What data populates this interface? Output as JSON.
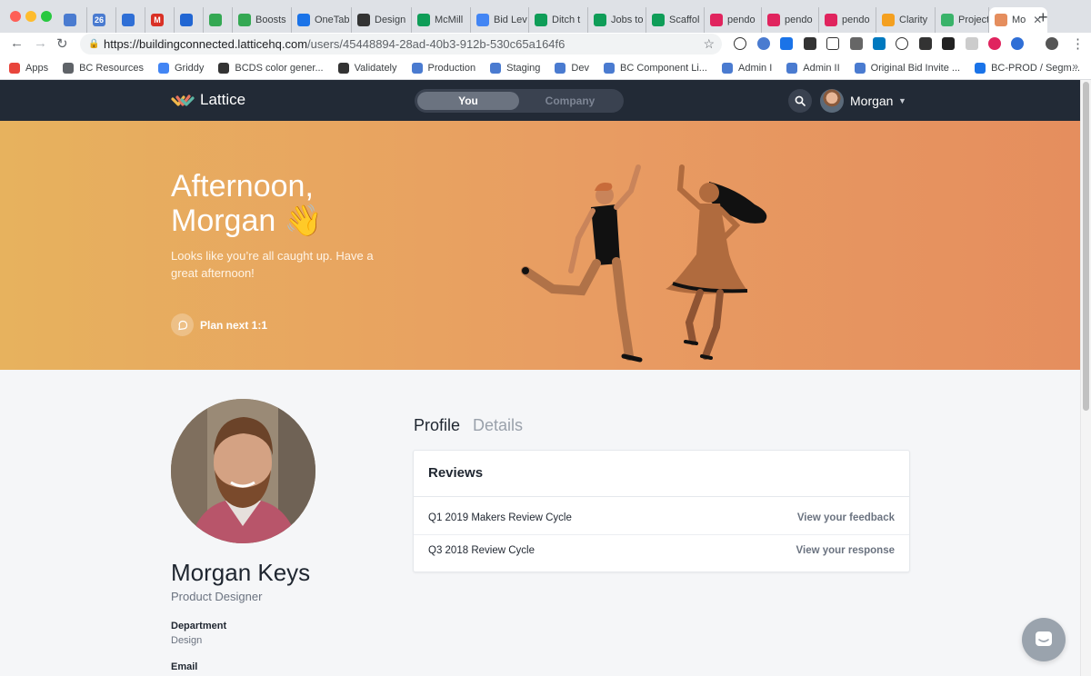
{
  "browser": {
    "tabs": [
      {
        "label": "",
        "color": "#4a7bd0"
      },
      {
        "label": "",
        "color": "#4a7bd0",
        "text": "26"
      },
      {
        "label": "",
        "color": "#2f6fd6"
      },
      {
        "label": "",
        "color": "#d93025",
        "text": "M"
      },
      {
        "label": "",
        "color": "#2166d3"
      },
      {
        "label": "",
        "color": "#34a853"
      },
      {
        "label": "Boosts",
        "color": "#34a853"
      },
      {
        "label": "OneTab",
        "color": "#1a73e8"
      },
      {
        "label": "Design",
        "color": "#333333"
      },
      {
        "label": "McMill",
        "color": "#0f9d58"
      },
      {
        "label": "Bid Lev",
        "color": "#4285f4"
      },
      {
        "label": "Ditch t",
        "color": "#0f9d58"
      },
      {
        "label": "Jobs to",
        "color": "#0f9d58"
      },
      {
        "label": "Scaffol",
        "color": "#0f9d58"
      },
      {
        "label": "pendo",
        "color": "#e0245e"
      },
      {
        "label": "pendo",
        "color": "#e0245e"
      },
      {
        "label": "pendo",
        "color": "#e0245e"
      },
      {
        "label": "Clarity",
        "color": "#f4a020"
      },
      {
        "label": "Project",
        "color": "#3ab36a"
      },
      {
        "label": "Mo",
        "color": "#e58e5e"
      }
    ],
    "new_tab": "+",
    "url_host": "https://buildingconnected.latticehq.com",
    "url_path": "/users/45448894-28ad-40b3-912b-530c65a164f6",
    "bookmarks": [
      {
        "label": "Apps",
        "color": "#e8453c"
      },
      {
        "label": "BC Resources",
        "color": "#5f6368"
      },
      {
        "label": "Griddy",
        "color": "#4285f4"
      },
      {
        "label": "BCDS color gener...",
        "color": "#333333"
      },
      {
        "label": "Validately",
        "color": "#333333"
      },
      {
        "label": "Production",
        "color": "#4a7bd0"
      },
      {
        "label": "Staging",
        "color": "#4a7bd0"
      },
      {
        "label": "Dev",
        "color": "#4a7bd0"
      },
      {
        "label": "BC Component Li...",
        "color": "#4a7bd0"
      },
      {
        "label": "Admin I",
        "color": "#4a7bd0"
      },
      {
        "label": "Admin II",
        "color": "#4a7bd0"
      },
      {
        "label": "Original Bid Invite ...",
        "color": "#4a7bd0"
      },
      {
        "label": "BC-PROD / Segm...",
        "color": "#1a73e8"
      }
    ],
    "bookmarks_more": "»"
  },
  "header": {
    "brand": "Lattice",
    "switch_you": "You",
    "switch_company": "Company",
    "user_name": "Morgan",
    "caret": "▼"
  },
  "hero": {
    "greeting_line1": "Afternoon,",
    "greeting_line2": "Morgan 👋",
    "subtext": "Looks like you’re all caught up. Have a great afternoon!",
    "plan_label": "Plan next 1:1"
  },
  "profile": {
    "name": "Morgan Keys",
    "title": "Product Designer",
    "department_label": "Department",
    "department_value": "Design",
    "email_label": "Email"
  },
  "tabs": {
    "profile": "Profile",
    "details": "Details"
  },
  "reviews": {
    "title": "Reviews",
    "items": [
      {
        "name": "Q1 2019 Makers Review Cycle",
        "action": "View your feedback"
      },
      {
        "name": "Q3 2018 Review Cycle",
        "action": "View your response"
      }
    ]
  },
  "colors": {
    "header_bg": "#222a36",
    "hero_start": "#e7b25e",
    "hero_end": "#e58e5e"
  }
}
